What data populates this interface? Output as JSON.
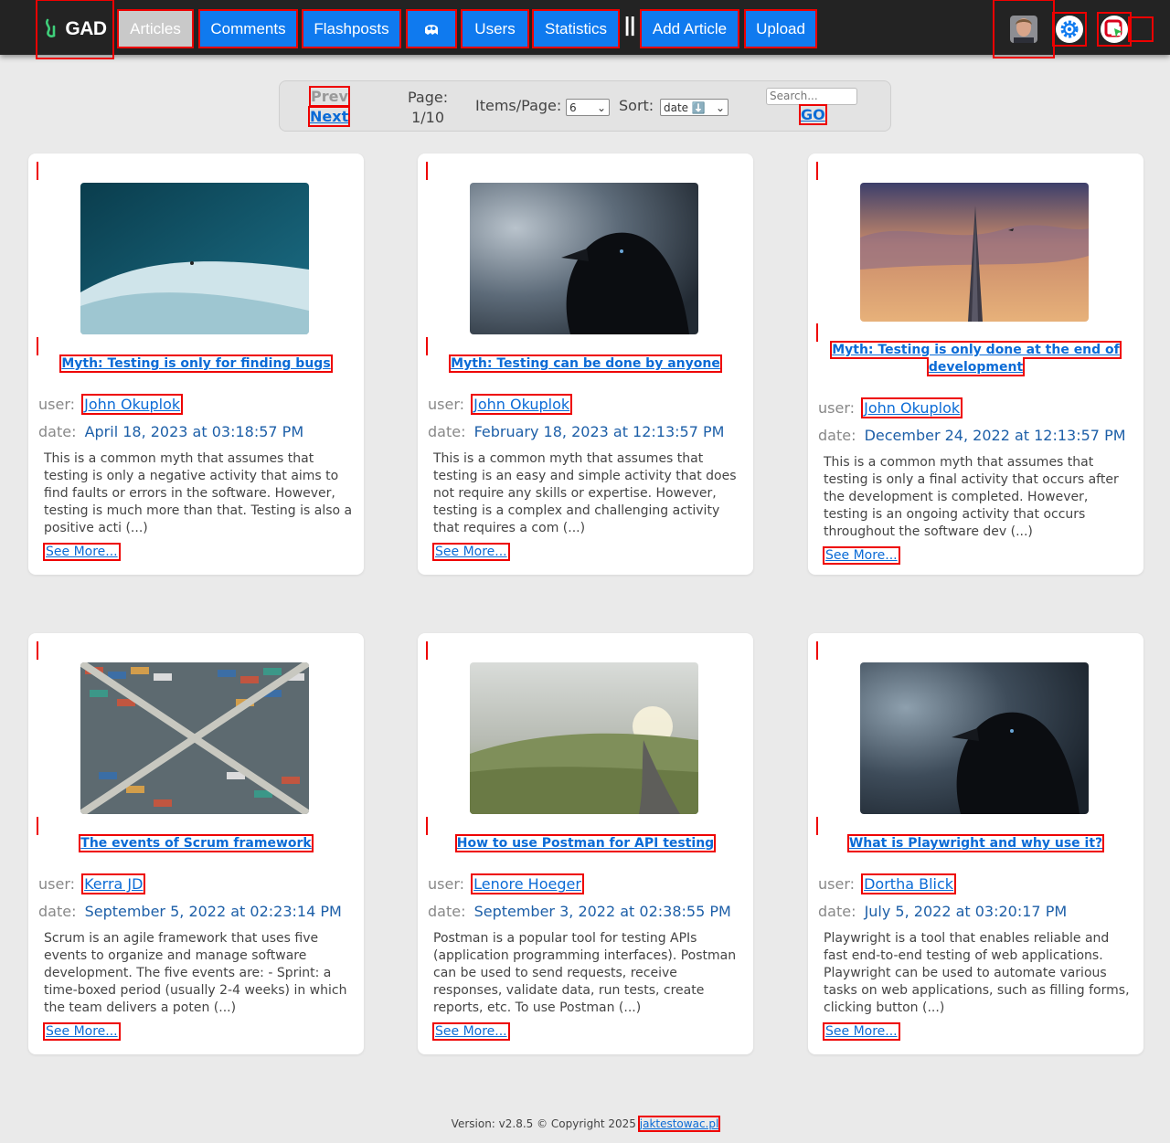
{
  "nav": {
    "logo_text": "GAD",
    "items": [
      {
        "label": "Articles",
        "active": true
      },
      {
        "label": "Comments"
      },
      {
        "label": "Flashposts"
      },
      {
        "label": "",
        "icon": "game-icon"
      },
      {
        "label": "Users"
      },
      {
        "label": "Statistics"
      }
    ],
    "separator": "||",
    "actions": [
      {
        "label": "Add Article"
      },
      {
        "label": "Upload"
      }
    ],
    "settings_icon": "gear-icon",
    "login_icon": "login-icon"
  },
  "pager": {
    "prev_label": "Prev",
    "next_label": "Next",
    "page_label": "Page:",
    "page_value": "1/10",
    "items_label": "Items/Page:",
    "items_value": "6",
    "sort_label": "Sort:",
    "sort_value": "date ⬇️",
    "search_placeholder": "Search...",
    "go_label": "GO"
  },
  "articles": [
    {
      "title": "Myth: Testing is only for finding bugs",
      "user_label": "user:",
      "user": "John Okuplok",
      "date_label": "date:",
      "date": "April 18, 2023 at 03:18:57 PM",
      "body": "This is a common myth that assumes that testing is only a negative activity that aims to find faults or errors in the software. However, testing is much more than that. Testing is also a positive acti (...)",
      "more": "See More..."
    },
    {
      "title": "Myth: Testing can be done by anyone",
      "user_label": "user:",
      "user": "John Okuplok",
      "date_label": "date:",
      "date": "February 18, 2023 at 12:13:57 PM",
      "body": "This is a common myth that assumes that testing is an easy and simple activity that does not require any skills or expertise. However, testing is a complex and challenging activity that requires a com (...)",
      "more": "See More..."
    },
    {
      "title": "Myth: Testing is only done at the end of development",
      "user_label": "user:",
      "user": "John Okuplok",
      "date_label": "date:",
      "date": "December 24, 2022 at 12:13:57 PM",
      "body": "This is a common myth that assumes that testing is only a final activity that occurs after the development is completed. However, testing is an ongoing activity that occurs throughout the software dev (...)",
      "more": "See More..."
    },
    {
      "title": "The events of Scrum framework",
      "user_label": "user:",
      "user": "Kerra JD",
      "date_label": "date:",
      "date": "September 5, 2022 at 02:23:14 PM",
      "body": "Scrum is an agile framework that uses five events to organize and manage software development. The five events are: - Sprint: a time-boxed period (usually 2-4 weeks) in which the team delivers a poten (...)",
      "more": "See More..."
    },
    {
      "title": "How to use Postman for API testing",
      "user_label": "user:",
      "user": "Lenore Hoeger",
      "date_label": "date:",
      "date": "September 3, 2022 at 02:38:55 PM",
      "body": "Postman is a popular tool for testing APIs (application programming interfaces). Postman can be used to send requests, receive responses, validate data, run tests, create reports, etc. To use Postman (...)",
      "more": "See More..."
    },
    {
      "title": "What is Playwright and why use it?",
      "user_label": "user:",
      "user": "Dortha Blick",
      "date_label": "date:",
      "date": "July 5, 2022 at 03:20:17 PM",
      "body": "Playwright is a tool that enables reliable and fast end-to-end testing of web applications. Playwright can be used to automate various tasks on web applications, such as filling forms, clicking button (...)",
      "more": "See More..."
    }
  ],
  "footer": {
    "text": "Version: v2.8.5 © Copyright 2025",
    "link": "jaktestowac.pl"
  }
}
